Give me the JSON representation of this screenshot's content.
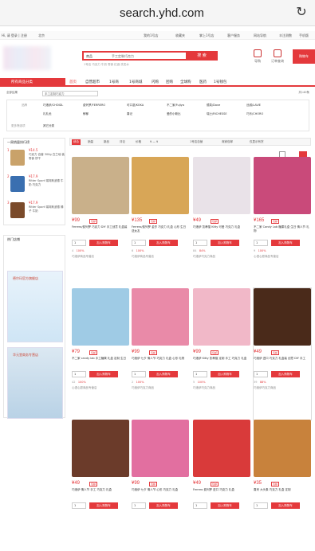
{
  "browser": {
    "url": "search.yhd.com"
  },
  "topnav": {
    "greeting": "Hi, 请 登录 | 注册",
    "city": "北京",
    "links": [
      "我的1号店",
      "收藏夹",
      "掌上1号店",
      "客户服务",
      "网站导航",
      "丰注测数",
      "手机版"
    ]
  },
  "search": {
    "category": "商品",
    "value": "手工定制巧克力",
    "button": "搜 索",
    "hotwords": "1号店 巧克力 牛奶 零食 红酒 洗发水"
  },
  "header_icons": [
    "导购",
    "订单查询",
    "购物车"
  ],
  "nav": {
    "all_categories": "所有商品分类",
    "items": [
      "首页",
      "自营超市",
      "1号商",
      "1号商城",
      "闪购",
      "团购",
      "全球购",
      "医药",
      "1号钱包"
    ]
  },
  "breadcrumb": {
    "label": "全部结果",
    "query": "手工定制巧克力",
    "count": "共140条"
  },
  "brands": {
    "label": "品牌",
    "items": [
      "巧洛伊/CHOIDL",
      "费列罗/FERRERO",
      "可口滋/KOKA",
      "不二家/Fujiya",
      "德芙/Dove",
      "丝绒/LAVIE",
      "礼礼优",
      "郁郁",
      "喜记",
      "爱的小斯比",
      "瑞士/RICHESSE",
      "巧乐/CHORO"
    ],
    "more_label": "更多筛选项",
    "other": "其它分类"
  },
  "sortbar": {
    "items": [
      "综合",
      "销量",
      "新品",
      "评论",
      "价格",
      "1号店自营",
      "商家包邮",
      "仅显示有货"
    ],
    "range": "¥ — ¥"
  },
  "rank": {
    "title": "一周销量排行榜",
    "items": [
      {
        "num": "1",
        "price": "¥14.5",
        "name": "巧克力 自营 300g 白兰地 装 零食 饼干"
      },
      {
        "num": "2",
        "price": "¥17.9",
        "name": "Ritter Sport 瑞特斯波德 牛奶 巧克力"
      },
      {
        "num": "3",
        "price": "¥17.9",
        "name": "Ritter Sport 瑞特斯波德 榛子 牛奶"
      }
    ]
  },
  "shops": {
    "title": "热门店铺",
    "ads": [
      "德尔玛官方旗舰店",
      "华元堂商务专营店"
    ]
  },
  "products": [
    {
      "price": "¥99",
      "tag": "包邮",
      "title": "Ferrero/费列罗 巧克力 DIY 手工创意 礼盒装",
      "qty": "1",
      "add": "加入购物车",
      "reviews": "4",
      "rate": "100%",
      "shop": "巧洛伊商品专营店",
      "color": "#c9b08a"
    },
    {
      "price": "¥135",
      "tag": "包邮",
      "title": "Ferrero/费列罗 金莎 巧克力 礼盒 心形 生日 送女友",
      "qty": "1",
      "add": "加入购物车",
      "reviews": "6",
      "rate": "100%",
      "shop": "巧洛伊商品专营店",
      "color": "#d8a657"
    },
    {
      "price": "¥49",
      "tag": "包邮",
      "title": "巧洛伊 凯蒂猫 Kitty 可爱 巧克力 礼盒",
      "qty": "1",
      "add": "加入购物车",
      "reviews": "84",
      "rate": "84%",
      "shop": "巧洛伊巧克力商品",
      "color": "#e9e2e8"
    },
    {
      "price": "¥165",
      "tag": "包邮",
      "title": "不二家 Candy Lab 糖果礼盒 生日 情人节 礼物",
      "qty": "1",
      "add": "加入购物车",
      "reviews": "9",
      "rate": "100%",
      "shop": "心语心愿商品专营店",
      "color": "#c94a7a"
    },
    {
      "price": "¥79",
      "tag": "包邮",
      "title": "不二家 candy lab 手工糖果 礼盒 定制 生日",
      "qty": "1",
      "add": "加入购物车",
      "reviews": "42",
      "rate": "100%",
      "shop": "心语心愿商品专营店",
      "color": "#9fcbe5"
    },
    {
      "price": "¥99",
      "tag": "包邮",
      "title": "巧洛伊 七夕 情人节 巧克力 礼盒 心形 礼物",
      "qty": "1",
      "add": "加入购物车",
      "reviews": "2",
      "rate": "100%",
      "shop": "巧洛伊巧克力商品",
      "color": "#e98aa8"
    },
    {
      "price": "¥99",
      "tag": "包邮",
      "title": "巧洛伊 Kitty 凯蒂猫 定制 手工 巧克力 礼盒",
      "qty": "1",
      "add": "加入购物车",
      "reviews": "5",
      "rate": "100%",
      "shop": "巧洛伊巧克力商品",
      "color": "#f1b8c8"
    },
    {
      "price": "¥49",
      "tag": "包邮",
      "title": "巧洛伊 进口 巧克力 礼盒装 创意 DIY 手工",
      "qty": "1",
      "add": "加入购物车",
      "reviews": "39",
      "rate": "88%",
      "shop": "巧洛伊巧克力商品",
      "color": "#4a2a1a"
    },
    {
      "price": "¥49",
      "tag": "包邮",
      "title": "巧洛伊 情人节 手工 巧克力 礼盒",
      "qty": "1",
      "add": "加入购物车",
      "reviews": "",
      "rate": "",
      "shop": "",
      "color": "#6b3b2a"
    },
    {
      "price": "¥99",
      "tag": "包邮",
      "title": "巧洛伊 七夕 情人节 心形 巧克力 礼盒",
      "qty": "1",
      "add": "加入购物车",
      "reviews": "",
      "rate": "",
      "shop": "",
      "color": "#e26fa0"
    },
    {
      "price": "¥49",
      "tag": "包邮",
      "title": "Ferrero 费列罗 进口 巧克力 礼盒",
      "qty": "1",
      "add": "加入购物车",
      "reviews": "",
      "rate": "",
      "shop": "",
      "color": "#d93a3a"
    },
    {
      "price": "¥35",
      "tag": "包邮",
      "title": "喜来 大头象 巧克力 礼盒 定制",
      "qty": "1",
      "add": "加入购物车",
      "reviews": "",
      "rate": "",
      "shop": "",
      "color": "#c8823c"
    }
  ]
}
